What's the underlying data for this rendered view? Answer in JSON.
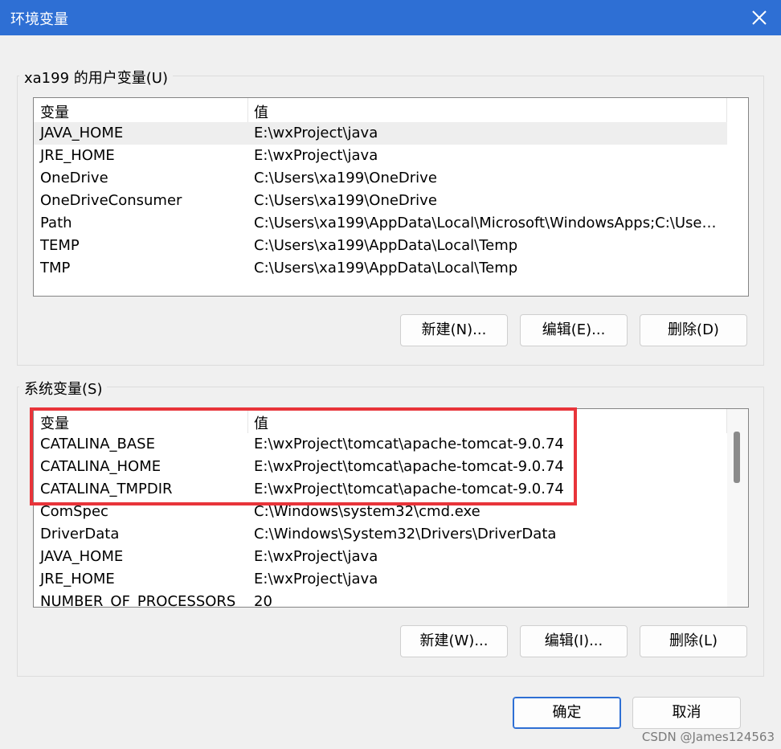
{
  "window": {
    "title": "环境变量"
  },
  "user_vars": {
    "group_label": "xa199 的用户变量(U)",
    "col_name": "变量",
    "col_value": "值",
    "rows": [
      {
        "name": "JAVA_HOME",
        "value": "E:\\wxProject\\java"
      },
      {
        "name": "JRE_HOME",
        "value": "E:\\wxProject\\java"
      },
      {
        "name": "OneDrive",
        "value": "C:\\Users\\xa199\\OneDrive"
      },
      {
        "name": "OneDriveConsumer",
        "value": "C:\\Users\\xa199\\OneDrive"
      },
      {
        "name": "Path",
        "value": "C:\\Users\\xa199\\AppData\\Local\\Microsoft\\WindowsApps;C:\\Users\\..."
      },
      {
        "name": "TEMP",
        "value": "C:\\Users\\xa199\\AppData\\Local\\Temp"
      },
      {
        "name": "TMP",
        "value": "C:\\Users\\xa199\\AppData\\Local\\Temp"
      }
    ],
    "buttons": {
      "new": "新建(N)...",
      "edit": "编辑(E)...",
      "delete": "删除(D)"
    }
  },
  "system_vars": {
    "group_label": "系统变量(S)",
    "col_name": "变量",
    "col_value": "值",
    "rows": [
      {
        "name": "CATALINA_BASE",
        "value": "E:\\wxProject\\tomcat\\apache-tomcat-9.0.74"
      },
      {
        "name": "CATALINA_HOME",
        "value": "E:\\wxProject\\tomcat\\apache-tomcat-9.0.74"
      },
      {
        "name": "CATALINA_TMPDIR",
        "value": "E:\\wxProject\\tomcat\\apache-tomcat-9.0.74"
      },
      {
        "name": "ComSpec",
        "value": "C:\\Windows\\system32\\cmd.exe"
      },
      {
        "name": "DriverData",
        "value": "C:\\Windows\\System32\\Drivers\\DriverData"
      },
      {
        "name": "JAVA_HOME",
        "value": "E:\\wxProject\\java"
      },
      {
        "name": "JRE_HOME",
        "value": "E:\\wxProject\\java"
      },
      {
        "name": "NUMBER_OF_PROCESSORS",
        "value": "20"
      }
    ],
    "buttons": {
      "new": "新建(W)...",
      "edit": "编辑(I)...",
      "delete": "删除(L)"
    }
  },
  "footer": {
    "ok": "确定",
    "cancel": "取消"
  },
  "watermark": "CSDN @James124563",
  "colors": {
    "titlebar": "#2e6fd4",
    "highlight": "#e8343a"
  }
}
